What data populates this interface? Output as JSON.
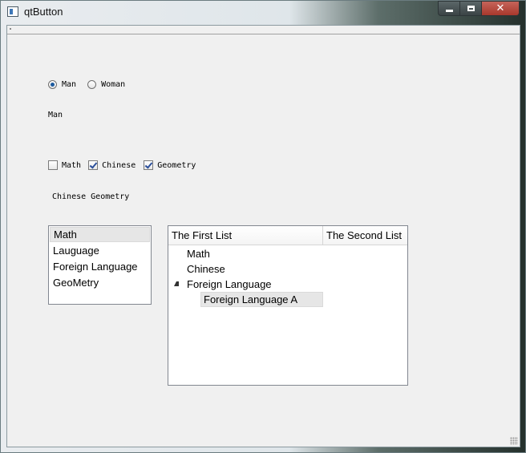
{
  "window": {
    "title": "qtButton"
  },
  "gender": {
    "options": [
      {
        "label": "Man",
        "checked": true
      },
      {
        "label": "Woman",
        "checked": false
      }
    ],
    "result_text": "Man"
  },
  "subjects": {
    "options": [
      {
        "label": "Math",
        "checked": false
      },
      {
        "label": "Chinese",
        "checked": true
      },
      {
        "label": "Geometry",
        "checked": true
      }
    ],
    "result_text": "Chinese Geometry"
  },
  "list_widget": {
    "items": [
      "Math",
      "Lauguage",
      "Foreign Language",
      "GeoMetry"
    ],
    "selected_index": 0
  },
  "tree_widget": {
    "headers": [
      "The First List",
      "The Second List"
    ],
    "items": [
      {
        "label": "Math"
      },
      {
        "label": "Chinese"
      },
      {
        "label": "Foreign Language",
        "expanded": true,
        "children": [
          "Foreign Language A"
        ]
      }
    ]
  }
}
